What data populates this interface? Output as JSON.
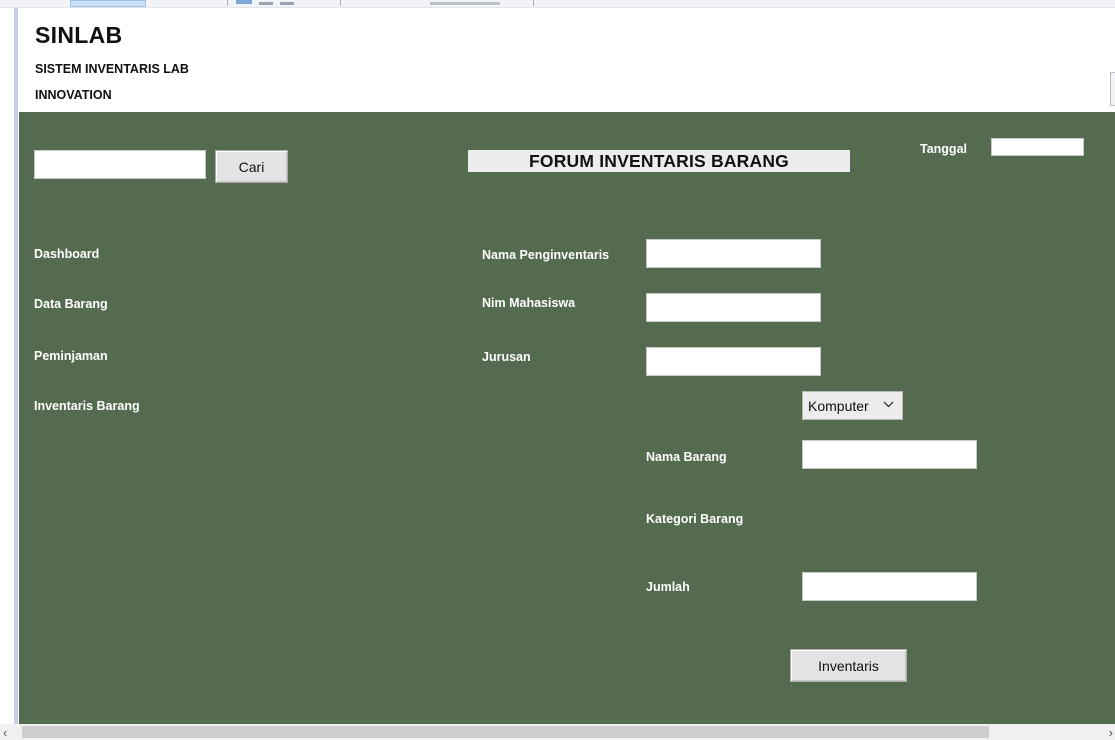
{
  "header": {
    "title": "SINLAB",
    "subtitle_line1": "SISTEM INVENTARIS LAB",
    "subtitle_line2": "INNOVATION"
  },
  "search": {
    "value": "",
    "button_label": "Cari"
  },
  "form_title": "FORUM INVENTARIS BARANG",
  "date": {
    "label": "Tanggal",
    "value": ""
  },
  "nav": {
    "items": [
      {
        "label": "Dashboard"
      },
      {
        "label": "Data Barang"
      },
      {
        "label": "Peminjaman"
      },
      {
        "label": "Inventaris Barang"
      }
    ]
  },
  "form": {
    "nama_penginventaris_label": "Nama Penginventaris",
    "nama_penginventaris_value": "",
    "nim_label": "Nim Mahasiswa",
    "nim_value": "",
    "jurusan_label": "Jurusan",
    "jurusan_value": "",
    "nama_barang_label": "Nama Barang",
    "nama_barang_value": "",
    "kategori_label": "Kategori Barang",
    "kategori_selected": "Komputer",
    "jumlah_label": "Jumlah",
    "jumlah_value": "",
    "submit_label": "Inventaris"
  },
  "colors": {
    "panel_bg": "#556b50",
    "label_text": "#ffffff"
  },
  "icons": {
    "dropdown": "chevron-down-icon",
    "scroll_left": "scroll-left-arrow-icon",
    "scroll_right": "scroll-right-arrow-icon"
  }
}
